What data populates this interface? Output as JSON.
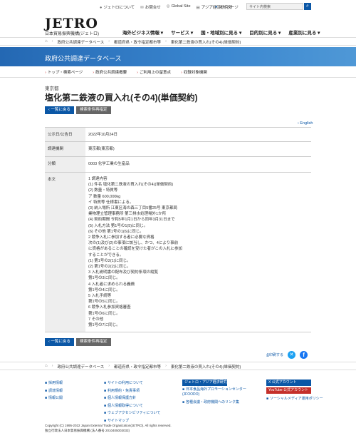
{
  "header": {
    "logo": "JETRO",
    "logo_sub": "日本貿易振興機構(ジェトロ)",
    "toplinks": [
      {
        "icon": "info-icon",
        "label": "ジェトロについて"
      },
      {
        "icon": "mail-icon",
        "label": "お問合せ"
      },
      {
        "icon": "globe-icon",
        "label": "Global Site"
      },
      {
        "icon": "book-icon",
        "label": "アジア経済研究所"
      }
    ],
    "mypage": "マイページ",
    "search_placeholder": "サイト内検索",
    "mainnav": [
      "海外ビジネス情報 ▾",
      "サービス ▾",
      "国・地域別に見る ▾",
      "目的別に見る ▾",
      "産業別に見る ▾"
    ]
  },
  "breadcrumb": [
    "政府公共調達データベース",
    "都道府県・政令指定都市等",
    "東化第二鉄液の買入れ(その4)(単価契約)"
  ],
  "banner_title": "政府公共調達データベース",
  "secnav": [
    "トップ・検索ページ",
    "政府公共調達概要",
    "ご利用上の留意点",
    "収録対象機関"
  ],
  "page": {
    "prefecture": "東京都",
    "title": "塩化第二鉄液の買入れ(その4)(単価契約)",
    "back_label": "一覧に戻る",
    "conditions_label": "検索条件再指定",
    "english": "English"
  },
  "table": {
    "rows": [
      {
        "label": "公示日/公告日",
        "value": "2022年10月24日"
      },
      {
        "label": "調達機関",
        "value": "東京都(東京都)"
      },
      {
        "label": "分類",
        "value": "0003 化学工業の生産品"
      }
    ],
    "body_label": "本文",
    "body_lines": [
      "1 調達内容",
      "(1) 件名 塩化第二鉄液の買入れ(その4)(単価契約)",
      "(2) 数量・特質等",
      "ア 数量 600,000kg",
      "イ 特質等 仕様書による。",
      "(3) 納入場所 江東区海の森三丁目5番25号 東京都局",
      "業物理立管理事務所 第三排水処理場外1か所",
      "(4) 契約期間 令和5年1月1日から同年3月31日まで",
      "(5) 入札方法 第1号の1(5)に同じ。",
      "(6) その他 第1号の1(6)に同じ。",
      "2 競争入札に参加する者に必要な資格",
      "次の(1)及び(2)の事項に該当し、かつ、4により事前",
      "に資格があることの確認を受けた者がこの入札に参加",
      "することができる。",
      "(1) 第1号の2(1)に同じ。",
      "(2) 第1号の2(2)に同じ。",
      "3 入札説明書の配布及び契約条項の縦覧",
      "第1号の3に同じ。",
      "4 入札者に求められる義務",
      "第1号の4に同じ。",
      "5 入札手続等",
      "第1号の5に同じ。",
      "6 競争入札参加資格審査",
      "第1号の6に同じ。",
      "7 その他",
      "第1号の7に同じ。"
    ]
  },
  "social": {
    "print": "印刷する"
  },
  "footer": {
    "col1": [
      "採用情報",
      "調達情報",
      "情報公開"
    ],
    "col2": [
      "サイトの利用について",
      "利用規約・免責事項",
      "個人情報保護方針",
      "個人情報取得について",
      "ウェブアクセシビリティについて",
      "サイトマップ"
    ],
    "col3_btn": "ジェトロ・アジア経済研究所",
    "col3": [
      "日本食品海外プロモーションセンター(JFOODO)",
      "各種会議・政府機関へのリンク集"
    ],
    "col4": [
      "X 公式アカウント",
      "YouTube 公式アカウント",
      "ソーシャルメディア運用ポリシー"
    ],
    "copyright": "Copyright (C) 1995-2022 Japan External Trade Organization(JETRO). All rights reserved.",
    "corp": "独立行政法人日本貿易振興機構 (法人番号 2010405003033)"
  }
}
